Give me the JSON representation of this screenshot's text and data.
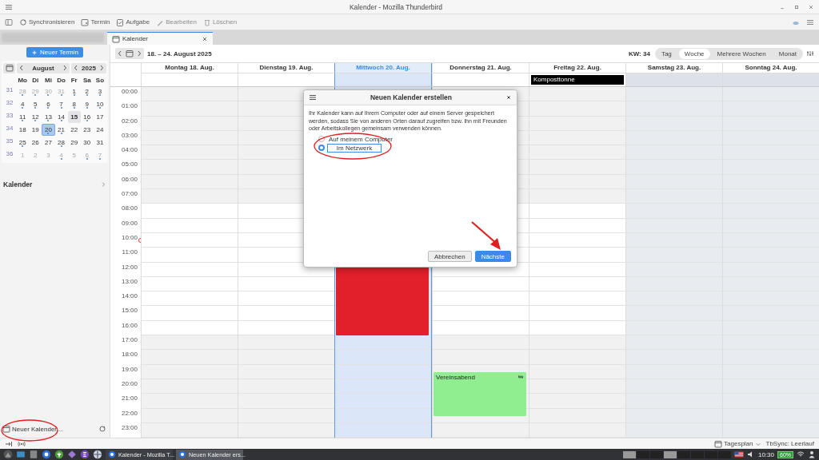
{
  "window": {
    "title": "Kalender - Mozilla Thunderbird"
  },
  "toolbar": [
    {
      "label": "Synchronisieren",
      "disabled": false
    },
    {
      "label": "Termin",
      "disabled": false
    },
    {
      "label": "Aufgabe",
      "disabled": false
    },
    {
      "label": "Bearbeiten",
      "disabled": true
    },
    {
      "label": "Löschen",
      "disabled": true
    }
  ],
  "tabs": [
    {
      "label": "Kalender",
      "selected": true
    }
  ],
  "sidebar": {
    "new_event_button": "Neuer Termin",
    "minimonth": {
      "month": "August",
      "year": "2025",
      "weekdays": [
        "Mo",
        "Di",
        "Mi",
        "Do",
        "Fr",
        "Sa",
        "So"
      ],
      "weeks": [
        {
          "number": "31",
          "days": [
            {
              "label": "28",
              "other_month": true,
              "has_events": true,
              "selected": false,
              "highlighted": false
            },
            {
              "label": "29",
              "other_month": true,
              "has_events": true,
              "selected": false,
              "highlighted": false
            },
            {
              "label": "30",
              "other_month": true,
              "has_events": true,
              "selected": false,
              "highlighted": false
            },
            {
              "label": "31",
              "other_month": true,
              "has_events": true,
              "selected": false,
              "highlighted": false
            },
            {
              "label": "1",
              "other_month": false,
              "has_events": true,
              "selected": false,
              "highlighted": false
            },
            {
              "label": "2",
              "other_month": false,
              "has_events": true,
              "selected": false,
              "highlighted": false
            },
            {
              "label": "3",
              "other_month": false,
              "has_events": true,
              "selected": false,
              "highlighted": false
            }
          ]
        },
        {
          "number": "32",
          "days": [
            {
              "label": "4",
              "other_month": false,
              "has_events": true,
              "selected": false,
              "highlighted": false
            },
            {
              "label": "5",
              "other_month": false,
              "has_events": true,
              "selected": false,
              "highlighted": false
            },
            {
              "label": "6",
              "other_month": false,
              "has_events": true,
              "selected": false,
              "highlighted": false
            },
            {
              "label": "7",
              "other_month": false,
              "has_events": true,
              "selected": false,
              "highlighted": false
            },
            {
              "label": "8",
              "other_month": false,
              "has_events": true,
              "selected": false,
              "highlighted": false
            },
            {
              "label": "9",
              "other_month": false,
              "has_events": true,
              "selected": false,
              "highlighted": false
            },
            {
              "label": "10",
              "other_month": false,
              "has_events": true,
              "selected": false,
              "highlighted": false
            }
          ]
        },
        {
          "number": "33",
          "days": [
            {
              "label": "11",
              "other_month": false,
              "has_events": true,
              "selected": false,
              "highlighted": false
            },
            {
              "label": "12",
              "other_month": false,
              "has_events": true,
              "selected": false,
              "highlighted": false
            },
            {
              "label": "13",
              "other_month": false,
              "has_events": true,
              "selected": false,
              "highlighted": false
            },
            {
              "label": "14",
              "other_month": false,
              "has_events": true,
              "selected": false,
              "highlighted": false
            },
            {
              "label": "15",
              "other_month": false,
              "has_events": false,
              "selected": false,
              "highlighted": true
            },
            {
              "label": "16",
              "other_month": false,
              "has_events": true,
              "selected": false,
              "highlighted": false
            },
            {
              "label": "17",
              "other_month": false,
              "has_events": false,
              "selected": false,
              "highlighted": false
            }
          ]
        },
        {
          "number": "34",
          "days": [
            {
              "label": "18",
              "other_month": false,
              "has_events": false,
              "selected": false,
              "highlighted": false
            },
            {
              "label": "19",
              "other_month": false,
              "has_events": false,
              "selected": false,
              "highlighted": false
            },
            {
              "label": "20",
              "other_month": false,
              "has_events": true,
              "selected": true,
              "highlighted": false
            },
            {
              "label": "21",
              "other_month": false,
              "has_events": true,
              "selected": false,
              "highlighted": false
            },
            {
              "label": "22",
              "other_month": false,
              "has_events": false,
              "selected": false,
              "highlighted": false
            },
            {
              "label": "23",
              "other_month": false,
              "has_events": false,
              "selected": false,
              "highlighted": false
            },
            {
              "label": "24",
              "other_month": false,
              "has_events": false,
              "selected": false,
              "highlighted": false
            }
          ]
        },
        {
          "number": "35",
          "days": [
            {
              "label": "25",
              "other_month": false,
              "has_events": true,
              "selected": false,
              "highlighted": false
            },
            {
              "label": "26",
              "other_month": false,
              "has_events": false,
              "selected": false,
              "highlighted": false
            },
            {
              "label": "27",
              "other_month": false,
              "has_events": false,
              "selected": false,
              "highlighted": false
            },
            {
              "label": "28",
              "other_month": false,
              "has_events": true,
              "selected": false,
              "highlighted": false
            },
            {
              "label": "29",
              "other_month": false,
              "has_events": false,
              "selected": false,
              "highlighted": false
            },
            {
              "label": "30",
              "other_month": false,
              "has_events": false,
              "selected": false,
              "highlighted": false
            },
            {
              "label": "31",
              "other_month": false,
              "has_events": false,
              "selected": false,
              "highlighted": false
            }
          ]
        },
        {
          "number": "36",
          "days": [
            {
              "label": "1",
              "other_month": true,
              "has_events": false,
              "selected": false,
              "highlighted": false
            },
            {
              "label": "2",
              "other_month": true,
              "has_events": false,
              "selected": false,
              "highlighted": false
            },
            {
              "label": "3",
              "other_month": true,
              "has_events": false,
              "selected": false,
              "highlighted": false
            },
            {
              "label": "4",
              "other_month": true,
              "has_events": true,
              "selected": false,
              "highlighted": false
            },
            {
              "label": "5",
              "other_month": true,
              "has_events": false,
              "selected": false,
              "highlighted": false
            },
            {
              "label": "6",
              "other_month": true,
              "has_events": true,
              "selected": false,
              "highlighted": false
            },
            {
              "label": "7",
              "other_month": true,
              "has_events": true,
              "selected": false,
              "highlighted": false
            }
          ]
        }
      ]
    },
    "calendars_heading": "Kalender",
    "new_calendar_button": "Neuer Kalender…"
  },
  "calendar": {
    "range": "18. – 24. August 2025",
    "week_label": "KW: 34",
    "views": [
      {
        "label": "Tag",
        "selected": false
      },
      {
        "label": "Woche",
        "selected": true
      },
      {
        "label": "Mehrere Wochen",
        "selected": false
      },
      {
        "label": "Monat",
        "selected": false
      }
    ],
    "hours": [
      "00:00",
      "01:00",
      "02:00",
      "03:00",
      "04:00",
      "05:00",
      "06:00",
      "07:00",
      "08:00",
      "09:00",
      "10:00",
      "11:00",
      "12:00",
      "13:00",
      "14:00",
      "15:00",
      "16:00",
      "17:00",
      "18:00",
      "19:00",
      "20:00",
      "21:00",
      "22:00",
      "23:00"
    ],
    "days": [
      {
        "label": "Montag 18. Aug.",
        "today": false,
        "weekend": false
      },
      {
        "label": "Dienstag 19. Aug.",
        "today": false,
        "weekend": false
      },
      {
        "label": "Mittwoch 20. Aug.",
        "today": true,
        "weekend": false,
        "events": [
          {
            "color": "#e2202b"
          }
        ]
      },
      {
        "label": "Donnerstag 21. Aug.",
        "today": false,
        "weekend": false,
        "events": [
          {
            "title": "Vereinsabend",
            "color": "#90ee90",
            "recurring": true
          }
        ]
      },
      {
        "label": "Freitag 22. Aug.",
        "today": false,
        "weekend": false,
        "all_day": [
          {
            "title": "Komposttonne",
            "color": "#000000"
          }
        ]
      },
      {
        "label": "Samstag 23. Aug.",
        "today": false,
        "weekend": true
      },
      {
        "label": "Sonntag 24. Aug.",
        "today": false,
        "weekend": true
      }
    ]
  },
  "dialog": {
    "title": "Neuen Kalender erstellen",
    "text": "Ihr Kalender kann auf Ihrem Computer oder auf einem Server gespeichert werden, sodass Sie von anderen Orten darauf zugreifen bzw. ihn mit Freunden oder Arbeitskollegen gemeinsam verwenden können.",
    "options": [
      {
        "label": "Auf meinem Computer",
        "selected": false
      },
      {
        "label": "Im Netzwerk",
        "selected": true
      }
    ],
    "buttons": [
      {
        "label": "Abbrechen",
        "primary": false
      },
      {
        "label": "Nächste",
        "primary": true
      }
    ]
  },
  "status_bar": [
    {
      "label": "Tagesplan",
      "kind": "dropdown"
    },
    {
      "label": "TbSync: Leerlauf",
      "kind": "text"
    }
  ],
  "taskbar": {
    "tasks": [
      {
        "label": "Kalender - Mozilla T...",
        "selected": false
      },
      {
        "label": "Neuen Kalender ers...",
        "selected": true
      }
    ],
    "clock": "10:30",
    "battery": "60%"
  }
}
